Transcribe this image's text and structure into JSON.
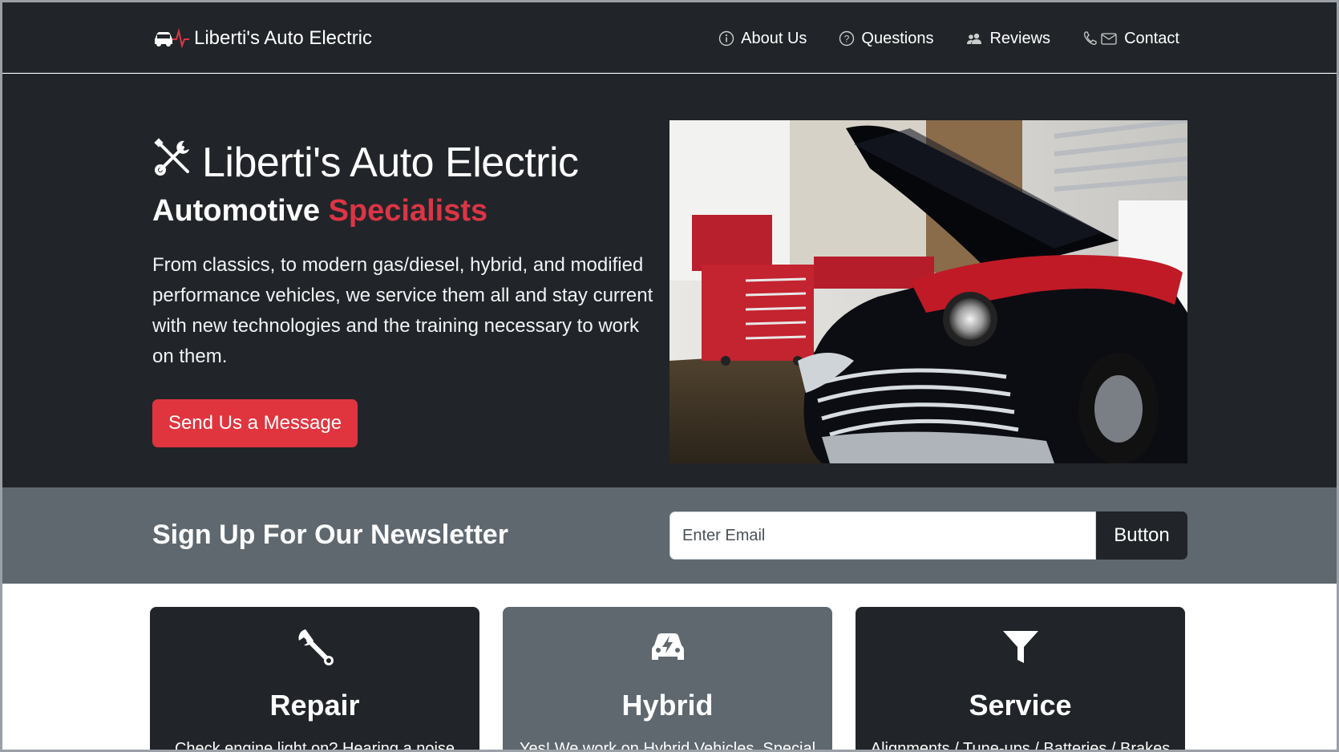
{
  "navbar": {
    "brand": "Liberti's Auto Electric",
    "links": [
      {
        "label": "About Us",
        "icon": "info-circle-icon"
      },
      {
        "label": "Questions",
        "icon": "question-circle-icon"
      },
      {
        "label": "Reviews",
        "icon": "people-icon"
      },
      {
        "label": "Contact",
        "icon": "phone-envelope-icon"
      }
    ]
  },
  "hero": {
    "title": "Liberti's Auto Electric",
    "subtitle_main": "Automotive",
    "subtitle_accent": "Specialists",
    "description": "From classics, to modern gas/diesel, hybrid, and modified performance vehicles, we service them all and stay current with new technologies and the training necessary to work on them.",
    "button_label": "Send Us a Message",
    "image_icon": "classic-car-photo"
  },
  "newsletter": {
    "title": "Sign Up For Our Newsletter",
    "input_placeholder": "Enter Email",
    "button_label": "Button"
  },
  "cards": [
    {
      "title": "Repair",
      "description": "Check engine light on? Hearing a noise",
      "icon": "wrench-icon"
    },
    {
      "title": "Hybrid",
      "description": "Yes! We work on Hybrid Vehicles. Special",
      "icon": "ev-car-icon"
    },
    {
      "title": "Service",
      "description": "Alignments / Tune-ups / Batteries / Brakes",
      "icon": "funnel-icon"
    }
  ],
  "colors": {
    "dark": "#212529",
    "gray": "#5f686f",
    "accent": "#dc3545"
  }
}
